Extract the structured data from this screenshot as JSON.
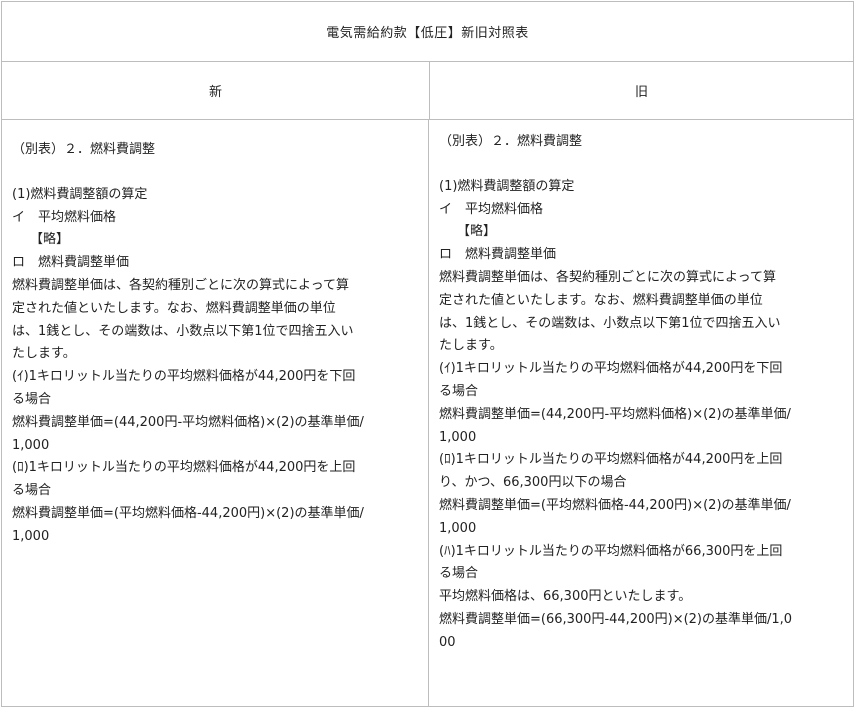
{
  "title": "電気需給約款【低圧】新旧対照表",
  "headers": {
    "new": "新",
    "old": "旧"
  },
  "new_column": {
    "section_heading": "（別表）２．燃料費調整",
    "lines": [
      "(1)燃料費調整額の算定",
      "イ　平均燃料価格",
      "【略】",
      "ロ　燃料費調整単価",
      "燃料費調整単価は、各契約種別ごとに次の算式によって算",
      "定された値といたします。なお、燃料費調整単価の単位",
      "は、1銭とし、その端数は、小数点以下第1位で四捨五入い",
      "たします。",
      "(ｲ)1キロリットル当たりの平均燃料価格が44,200円を下回",
      "る場合",
      "燃料費調整単価=(44,200円-平均燃料価格)×(2)の基準単価/",
      "1,000",
      "(ﾛ)1キロリットル当たりの平均燃料価格が44,200円を上回",
      "る場合",
      "燃料費調整単価=(平均燃料価格-44,200円)×(2)の基準単価/",
      "1,000"
    ]
  },
  "old_column": {
    "section_heading": "（別表）２．燃料費調整",
    "lines": [
      "(1)燃料費調整額の算定",
      "イ　平均燃料価格",
      "【略】",
      "ロ　燃料費調整単価",
      "燃料費調整単価は、各契約種別ごとに次の算式によって算",
      "定された値といたします。なお、燃料費調整単価の単位",
      "は、1銭とし、その端数は、小数点以下第1位で四捨五入い",
      "たします。",
      "(ｲ)1キロリットル当たりの平均燃料価格が44,200円を下回",
      "る場合",
      "燃料費調整単価=(44,200円-平均燃料価格)×(2)の基準単価/",
      "1,000",
      "(ﾛ)1キロリットル当たりの平均燃料価格が44,200円を上回",
      "り、かつ、66,300円以下の場合",
      "燃料費調整単価=(平均燃料価格-44,200円)×(2)の基準単価/",
      "1,000",
      "(ﾊ)1キロリットル当たりの平均燃料価格が66,300円を上回",
      "る場合",
      "平均燃料価格は、66,300円といたします。",
      "燃料費調整単価=(66,300円-44,200円)×(2)の基準単価/1,0",
      "00"
    ]
  }
}
